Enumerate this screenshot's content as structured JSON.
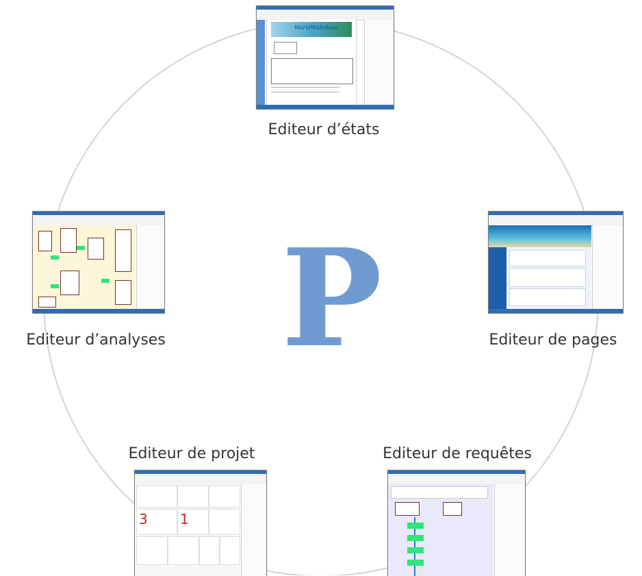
{
  "center_logo": {
    "letter": "P",
    "color": "#6f9bd0"
  },
  "ring_color": "#d4d4d4",
  "editors": [
    {
      "id": "etats",
      "label": "Editeur d’états"
    },
    {
      "id": "pages",
      "label": "Editeur de pages"
    },
    {
      "id": "requetes",
      "label": "Editeur de requêtes"
    },
    {
      "id": "projet",
      "label": "Editeur de projet"
    },
    {
      "id": "analyses",
      "label": "Editeur d’analyses"
    }
  ],
  "thumbnails": {
    "etats_logo_text": "WorldWideResa",
    "projet_numbers": [
      "3",
      "1"
    ]
  }
}
